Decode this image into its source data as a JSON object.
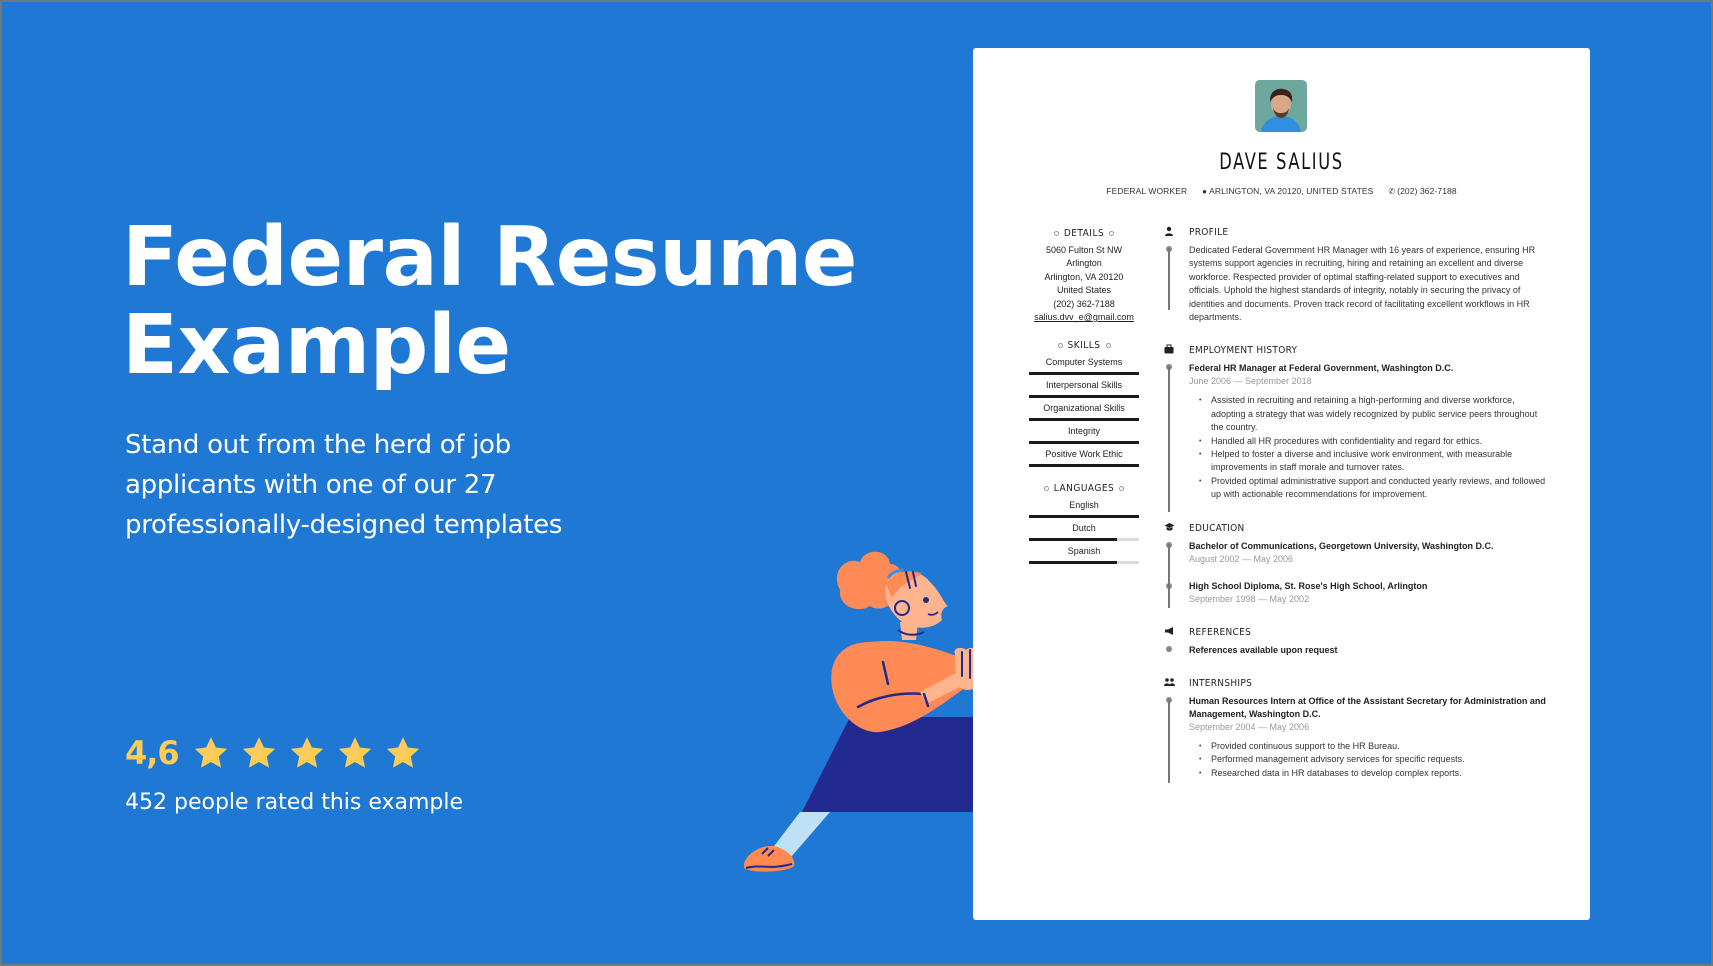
{
  "hero": {
    "title_line1": "Federal Resume",
    "title_line2": "Example",
    "subtitle": "Stand out from the herd of job applicants with one of our 27 professionally-designed templates"
  },
  "rating": {
    "score": "4,6",
    "stars_total": 5,
    "stars_filled": 5,
    "count_text": "452 people rated this example",
    "star_color": "#ffcc55"
  },
  "colors": {
    "background": "#1e78d4",
    "card": "#ffffff",
    "text_dark": "#222222",
    "date_gray": "#999999"
  },
  "resume": {
    "name": "DAVE SALIUS",
    "job_title": "FEDERAL WORKER",
    "location": "ARLINGTON, VA 20120, UNITED STATES",
    "phone": "(202) 362-7188",
    "details": {
      "heading": "DETAILS",
      "address_line1": "5060 Fulton St NW Arlington",
      "address_line2": "Arlington, VA 20120",
      "country": "United States",
      "phone": "(202) 362-7188",
      "email": "salius.dvv_e@gmail.com"
    },
    "skills": {
      "heading": "SKILLS",
      "items": [
        {
          "label": "Computer Systems",
          "level": 1.0
        },
        {
          "label": "Interpersonal Skills",
          "level": 1.0
        },
        {
          "label": "Organizational Skills",
          "level": 1.0
        },
        {
          "label": "Integrity",
          "level": 1.0
        },
        {
          "label": "Positive Work Ethic",
          "level": 1.0
        }
      ]
    },
    "languages": {
      "heading": "LANGUAGES",
      "items": [
        {
          "label": "English",
          "level": 1.0
        },
        {
          "label": "Dutch",
          "level": 0.8
        },
        {
          "label": "Spanish",
          "level": 0.8
        }
      ]
    },
    "profile": {
      "heading": "PROFILE",
      "text": "Dedicated Federal Government HR Manager with 16 years of experience, ensuring HR systems support agencies in recruiting, hiring and retaining an excellent and diverse workforce. Respected provider of optimal staffing-related support to executives and officials. Uphold the highest standards of integrity, notably in securing the privacy of identities and documents. Proven track record of facilitating excellent workflows in  HR departments."
    },
    "employment": {
      "heading": "EMPLOYMENT HISTORY",
      "entries": [
        {
          "title": "Federal HR Manager at Federal Government, Washington D.C.",
          "dates": "June 2006 — September 2018",
          "bullets": [
            "Assisted in recruiting and retaining a high-performing and diverse workforce, adopting a strategy that was widely recognized by public service peers throughout the country.",
            "Handled all HR procedures with confidentiality and regard for ethics.",
            "Helped to foster a diverse and inclusive work environment, with measurable improvements in staff morale and turnover rates.",
            "Provided optimal administrative support and conducted yearly reviews, and followed up with actionable recommendations for improvement."
          ]
        }
      ]
    },
    "education": {
      "heading": "EDUCATION",
      "entries": [
        {
          "title": "Bachelor of Communications, Georgetown University, Washington D.C.",
          "dates": "August 2002 — May 2006"
        },
        {
          "title": "High School Diploma, St. Rose's High School, Arlington",
          "dates": "September 1998 — May 2002"
        }
      ]
    },
    "references": {
      "heading": "REFERENCES",
      "text": "References available upon request"
    },
    "internships": {
      "heading": "INTERNSHIPS",
      "entries": [
        {
          "title": "Human Resources Intern at Office of the Assistant Secretary for Administration and Management, Washington D.C.",
          "dates": "September 2004 — May 2006",
          "bullets": [
            "Provided continuous support to the HR Bureau.",
            "Performed management advisory services for specific requests.",
            "Researched data in HR databases to develop complex reports."
          ]
        }
      ]
    }
  }
}
